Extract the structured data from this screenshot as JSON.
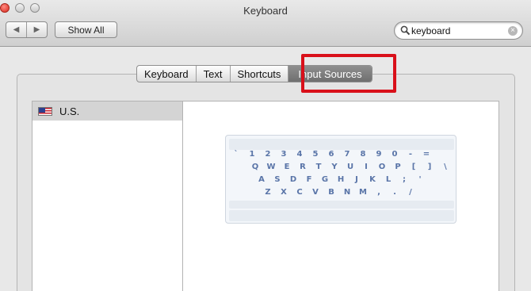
{
  "window": {
    "title": "Keyboard"
  },
  "toolbar": {
    "nav_back": "◀",
    "nav_forward": "▶",
    "show_all_label": "Show All",
    "search_value": "keyboard"
  },
  "tabs": [
    {
      "label": "Keyboard"
    },
    {
      "label": "Text"
    },
    {
      "label": "Shortcuts"
    },
    {
      "label": "Input Sources",
      "active": true
    }
  ],
  "input_sources": [
    {
      "label": "U.S.",
      "selected": true
    }
  ],
  "keyboard_layout": {
    "rows": [
      [
        "`",
        "1",
        "2",
        "3",
        "4",
        "5",
        "6",
        "7",
        "8",
        "9",
        "0",
        "-",
        "="
      ],
      [
        "Q",
        "W",
        "E",
        "R",
        "T",
        "Y",
        "U",
        "I",
        "O",
        "P",
        "[",
        "]",
        "\\"
      ],
      [
        "A",
        "S",
        "D",
        "F",
        "G",
        "H",
        "J",
        "K",
        "L",
        ";",
        "'"
      ],
      [
        "Z",
        "X",
        "C",
        "V",
        "B",
        "N",
        "M",
        ",",
        ".",
        "/"
      ]
    ]
  },
  "colors": {
    "highlight_box": "#d9101a",
    "key_text": "#5a75a8"
  }
}
